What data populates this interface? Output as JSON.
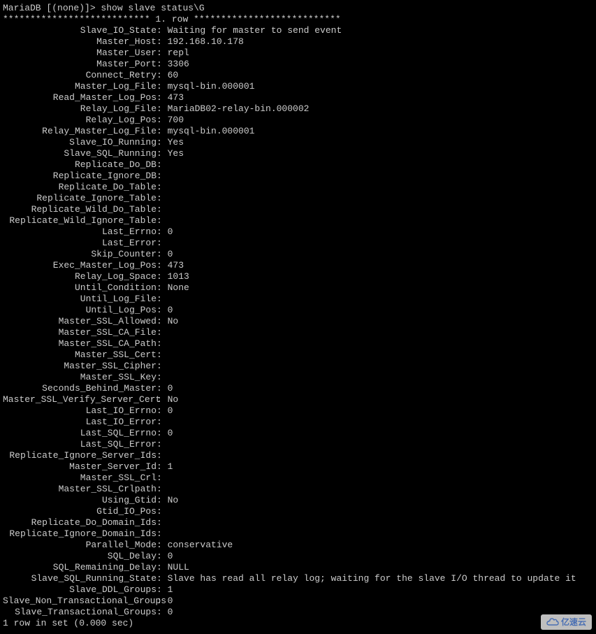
{
  "prompt": "MariaDB [(none)]> show slave status\\G",
  "row_header": "*************************** 1. row ***************************",
  "fields": [
    {
      "key": "Slave_IO_State",
      "val": "Waiting for master to send event"
    },
    {
      "key": "Master_Host",
      "val": "192.168.10.178"
    },
    {
      "key": "Master_User",
      "val": "repl"
    },
    {
      "key": "Master_Port",
      "val": "3306"
    },
    {
      "key": "Connect_Retry",
      "val": "60"
    },
    {
      "key": "Master_Log_File",
      "val": "mysql-bin.000001"
    },
    {
      "key": "Read_Master_Log_Pos",
      "val": "473"
    },
    {
      "key": "Relay_Log_File",
      "val": "MariaDB02-relay-bin.000002"
    },
    {
      "key": "Relay_Log_Pos",
      "val": "700"
    },
    {
      "key": "Relay_Master_Log_File",
      "val": "mysql-bin.000001"
    },
    {
      "key": "Slave_IO_Running",
      "val": "Yes"
    },
    {
      "key": "Slave_SQL_Running",
      "val": "Yes"
    },
    {
      "key": "Replicate_Do_DB",
      "val": ""
    },
    {
      "key": "Replicate_Ignore_DB",
      "val": ""
    },
    {
      "key": "Replicate_Do_Table",
      "val": ""
    },
    {
      "key": "Replicate_Ignore_Table",
      "val": ""
    },
    {
      "key": "Replicate_Wild_Do_Table",
      "val": ""
    },
    {
      "key": "Replicate_Wild_Ignore_Table",
      "val": ""
    },
    {
      "key": "Last_Errno",
      "val": "0"
    },
    {
      "key": "Last_Error",
      "val": ""
    },
    {
      "key": "Skip_Counter",
      "val": "0"
    },
    {
      "key": "Exec_Master_Log_Pos",
      "val": "473"
    },
    {
      "key": "Relay_Log_Space",
      "val": "1013"
    },
    {
      "key": "Until_Condition",
      "val": "None"
    },
    {
      "key": "Until_Log_File",
      "val": ""
    },
    {
      "key": "Until_Log_Pos",
      "val": "0"
    },
    {
      "key": "Master_SSL_Allowed",
      "val": "No"
    },
    {
      "key": "Master_SSL_CA_File",
      "val": ""
    },
    {
      "key": "Master_SSL_CA_Path",
      "val": ""
    },
    {
      "key": "Master_SSL_Cert",
      "val": ""
    },
    {
      "key": "Master_SSL_Cipher",
      "val": ""
    },
    {
      "key": "Master_SSL_Key",
      "val": ""
    },
    {
      "key": "Seconds_Behind_Master",
      "val": "0"
    },
    {
      "key": "Master_SSL_Verify_Server_Cert",
      "val": "No"
    },
    {
      "key": "Last_IO_Errno",
      "val": "0"
    },
    {
      "key": "Last_IO_Error",
      "val": ""
    },
    {
      "key": "Last_SQL_Errno",
      "val": "0"
    },
    {
      "key": "Last_SQL_Error",
      "val": ""
    },
    {
      "key": "Replicate_Ignore_Server_Ids",
      "val": ""
    },
    {
      "key": "Master_Server_Id",
      "val": "1"
    },
    {
      "key": "Master_SSL_Crl",
      "val": ""
    },
    {
      "key": "Master_SSL_Crlpath",
      "val": ""
    },
    {
      "key": "Using_Gtid",
      "val": "No"
    },
    {
      "key": "Gtid_IO_Pos",
      "val": ""
    },
    {
      "key": "Replicate_Do_Domain_Ids",
      "val": ""
    },
    {
      "key": "Replicate_Ignore_Domain_Ids",
      "val": ""
    },
    {
      "key": "Parallel_Mode",
      "val": "conservative"
    },
    {
      "key": "SQL_Delay",
      "val": "0"
    },
    {
      "key": "SQL_Remaining_Delay",
      "val": "NULL"
    },
    {
      "key": "Slave_SQL_Running_State",
      "val": "Slave has read all relay log; waiting for the slave I/O thread to update it"
    },
    {
      "key": "Slave_DDL_Groups",
      "val": "1"
    },
    {
      "key": "Slave_Non_Transactional_Groups",
      "val": "0"
    },
    {
      "key": "Slave_Transactional_Groups",
      "val": "0"
    }
  ],
  "footer": "1 row in set (0.000 sec)",
  "watermark": "亿速云"
}
